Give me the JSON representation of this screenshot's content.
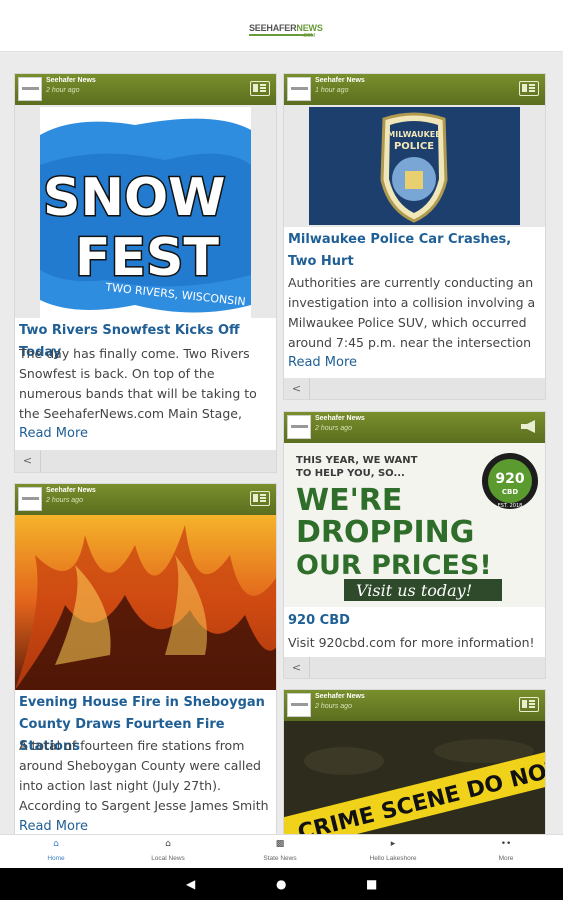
{
  "app": {
    "logo_main": "SEEHAFER",
    "logo_accent": "NEWS",
    "logo_sub": ".COM"
  },
  "cards": [
    {
      "source": "Seehafer News",
      "time": "2 hour ago",
      "image_text": {
        "line1": "SNOW",
        "line2": "FEST",
        "caption": "TWO RIVERS, WISCONSIN"
      },
      "headline": "Two Rivers Snowfest Kicks Off Today",
      "excerpt": "The day has finally come. Two Rivers Snowfest is back. On top of the numerous bands that will be taking to the SeehaferNews.com Main Stage,",
      "read_more": "Read More"
    },
    {
      "source": "Seehafer News",
      "time": "1 hour ago",
      "image_text": {
        "badge_top": "MILWAUKEE",
        "badge_bottom": "POLICE"
      },
      "headline": "Milwaukee Police Car Crashes, Two Hurt",
      "excerpt": "Authorities are currently conducting an investigation into a collision involving a Milwaukee Police SUV, which occurred around 7:45 p.m. near the intersection",
      "read_more": "Read More"
    },
    {
      "source": "Seehafer News",
      "time": "2 hours ago",
      "image_text": {
        "line1": "THIS YEAR, WE WANT",
        "line2": "TO HELP YOU, SO...",
        "line3": "WE'RE",
        "line4": "DROPPING",
        "line5": "OUR PRICES!",
        "cta": "Visit us today!",
        "badge": "920",
        "badge_sub": "CBD",
        "badge_est": "EST. 2018"
      },
      "headline": "920 CBD",
      "excerpt": "Visit 920cbd.com for more information!"
    },
    {
      "source": "Seehafer News",
      "time": "2 hours ago",
      "headline": "Evening House Fire in Sheboygan County Draws Fourteen Fire Stations",
      "excerpt": "A total of fourteen fire stations from around Sheboygan County were called into action last night (July 27th). According to Sargent Jesse James Smith",
      "read_more": "Read More"
    },
    {
      "source": "Seehafer News",
      "time": "2 hours ago",
      "image_text": {
        "tape": "CRIME SCENE DO NOT CROSS"
      }
    }
  ],
  "nav": [
    {
      "label": "Home",
      "icon": "home-icon"
    },
    {
      "label": "Local News",
      "icon": "home-icon"
    },
    {
      "label": "State News",
      "icon": "building-icon"
    },
    {
      "label": "Hello Lakeshore",
      "icon": "speaker-icon"
    },
    {
      "label": "More",
      "icon": "more-icon"
    }
  ],
  "colors": {
    "header_green": "#6b7f26",
    "link_blue": "#1f5f95",
    "nav_active": "#3b7fc7"
  }
}
